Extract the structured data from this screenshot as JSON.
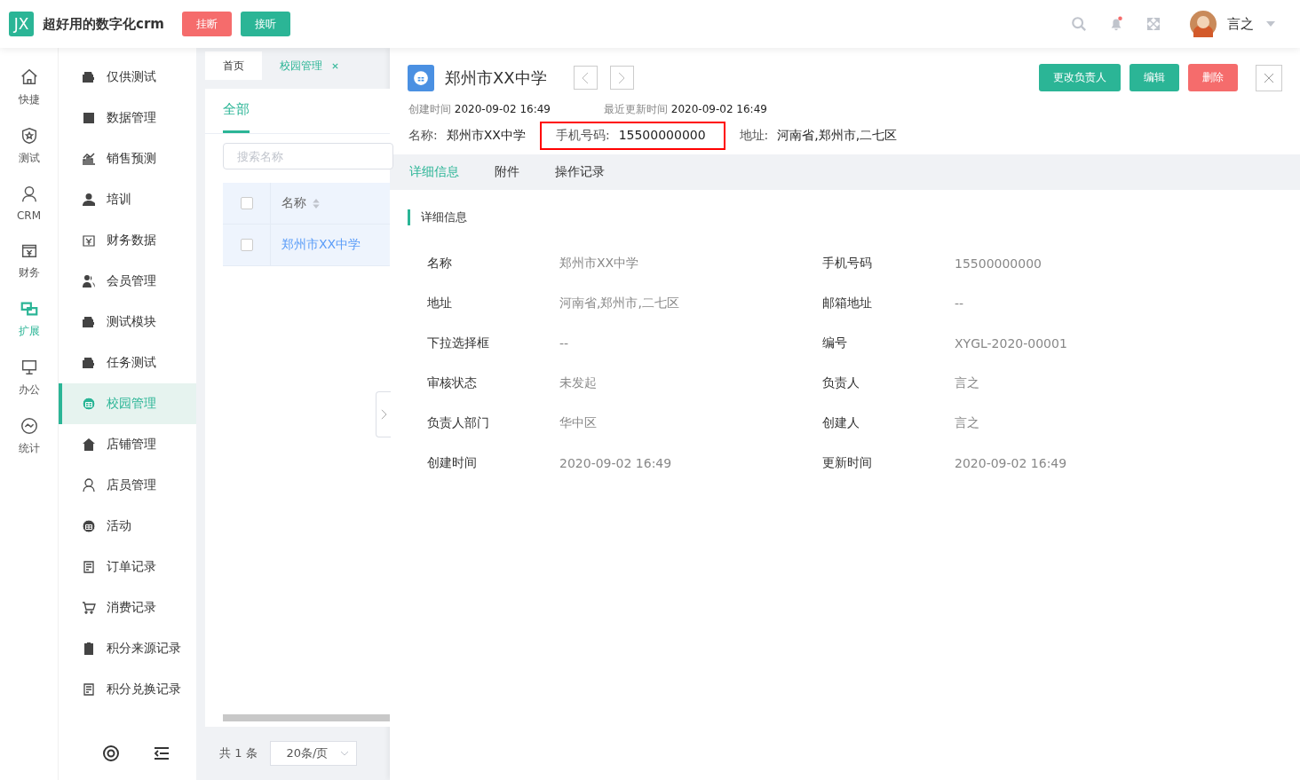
{
  "header": {
    "logo": "JX",
    "title": "超好用的数字化crm",
    "buttons": [
      {
        "label": "挂断",
        "kind": "danger"
      },
      {
        "label": "接听",
        "kind": "primary"
      }
    ],
    "notification_dot": true,
    "user": "言之"
  },
  "rail": [
    {
      "label": "快捷",
      "selected": false
    },
    {
      "label": "测试",
      "selected": false
    },
    {
      "label": "CRM",
      "selected": false
    },
    {
      "label": "财务",
      "selected": false
    },
    {
      "label": "扩展",
      "selected": true
    },
    {
      "label": "办公",
      "selected": false
    },
    {
      "label": "统计",
      "selected": false
    }
  ],
  "menu": [
    {
      "label": "仅供测试",
      "selected": false
    },
    {
      "label": "数据管理",
      "selected": false
    },
    {
      "label": "销售预测",
      "selected": false
    },
    {
      "label": "培训",
      "selected": false
    },
    {
      "label": "财务数据",
      "selected": false
    },
    {
      "label": "会员管理",
      "selected": false
    },
    {
      "label": "测试模块",
      "selected": false
    },
    {
      "label": "任务测试",
      "selected": false
    },
    {
      "label": "校园管理",
      "selected": true
    },
    {
      "label": "店铺管理",
      "selected": false
    },
    {
      "label": "店员管理",
      "selected": false
    },
    {
      "label": "活动",
      "selected": false
    },
    {
      "label": "订单记录",
      "selected": false
    },
    {
      "label": "消费记录",
      "selected": false
    },
    {
      "label": "积分来源记录",
      "selected": false
    },
    {
      "label": "积分兑换记录",
      "selected": false
    }
  ],
  "page_tabs": [
    {
      "label": "首页",
      "selected": false,
      "closable": false
    },
    {
      "label": "校园管理",
      "selected": true,
      "closable": true
    }
  ],
  "list": {
    "filter_tab": "全部",
    "search": {
      "placeholder": "搜索名称"
    },
    "column": "名称",
    "all_checked": false,
    "rows": [
      {
        "name": "郑州市XX中学",
        "checked": false
      }
    ],
    "total": "共 1 条",
    "page_size": "20条/页"
  },
  "detail": {
    "title": "郑州市XX中学",
    "created_label": "创建时间",
    "created": "2020-09-02 16:49",
    "updated_label": "最近更新时间",
    "updated": "2020-09-02 16:49",
    "summary": [
      {
        "label": "名称:",
        "value": "郑州市XX中学",
        "highlighted": false
      },
      {
        "label": "手机号码:",
        "value": "15500000000",
        "highlighted": true
      },
      {
        "label": "地址:",
        "value": "河南省,郑州市,二七区",
        "highlighted": false
      }
    ],
    "actions": [
      {
        "label": "更改负责人",
        "kind": "primary"
      },
      {
        "label": "编辑",
        "kind": "primary"
      },
      {
        "label": "删除",
        "kind": "danger"
      }
    ],
    "tabs": [
      {
        "label": "详细信息",
        "selected": true
      },
      {
        "label": "附件",
        "selected": false
      },
      {
        "label": "操作记录",
        "selected": false
      }
    ],
    "section": "详细信息",
    "fields": [
      {
        "label": "名称",
        "value": "郑州市XX中学"
      },
      {
        "label": "手机号码",
        "value": "15500000000"
      },
      {
        "label": "地址",
        "value": "河南省,郑州市,二七区"
      },
      {
        "label": "邮箱地址",
        "value": "--"
      },
      {
        "label": "下拉选择框",
        "value": "--"
      },
      {
        "label": "编号",
        "value": "XYGL-2020-00001"
      },
      {
        "label": "审核状态",
        "value": "未发起"
      },
      {
        "label": "负责人",
        "value": "言之"
      },
      {
        "label": "负责人部门",
        "value": "华中区"
      },
      {
        "label": "创建人",
        "value": "言之"
      },
      {
        "label": "创建时间",
        "value": "2020-09-02 16:49"
      },
      {
        "label": "更新时间",
        "value": "2020-09-02 16:49"
      }
    ]
  }
}
